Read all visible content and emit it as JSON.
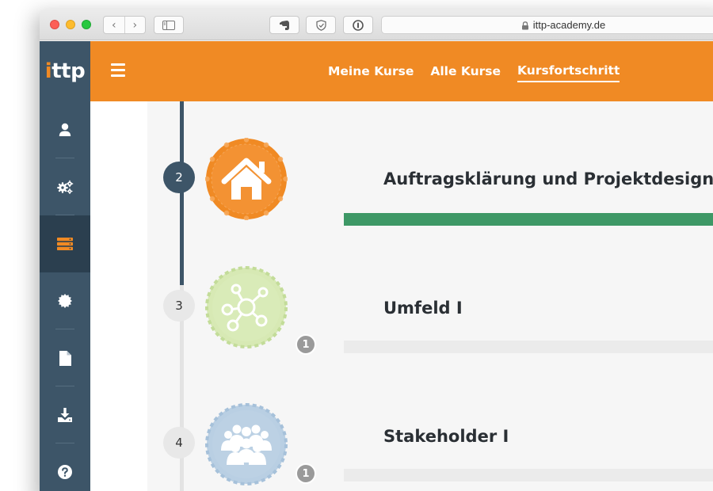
{
  "browser": {
    "url": "ittp-academy.de"
  },
  "brand": {
    "logo_main": "ttp",
    "logo_i": "i",
    "accent": "#f08a24",
    "sidebar_color": "#3d5568",
    "progress_color": "#3e9866"
  },
  "sidebar": {
    "items": [
      {
        "icon": "user-icon"
      },
      {
        "icon": "gears-icon"
      },
      {
        "icon": "server-stack-icon",
        "active": true
      },
      {
        "icon": "badge-icon"
      },
      {
        "icon": "document-icon"
      },
      {
        "icon": "download-icon"
      },
      {
        "icon": "help-icon"
      }
    ]
  },
  "header": {
    "nav": [
      "Meine Kurse",
      "Alle Kurse",
      "Kursfortschritt"
    ],
    "current": "Kursfortschritt"
  },
  "modules": [
    {
      "number": "2",
      "title": "Auftragsklärung und Projektdesign",
      "icon": "house-icon",
      "status": "completed",
      "progress": 1.0
    },
    {
      "number": "3",
      "title": "Umfeld I",
      "icon": "network-icon",
      "status": "open",
      "count": "1",
      "progress": 0.0
    },
    {
      "number": "4",
      "title": "Stakeholder I",
      "icon": "group-icon",
      "status": "open",
      "count": "1",
      "progress": 0.0
    }
  ]
}
